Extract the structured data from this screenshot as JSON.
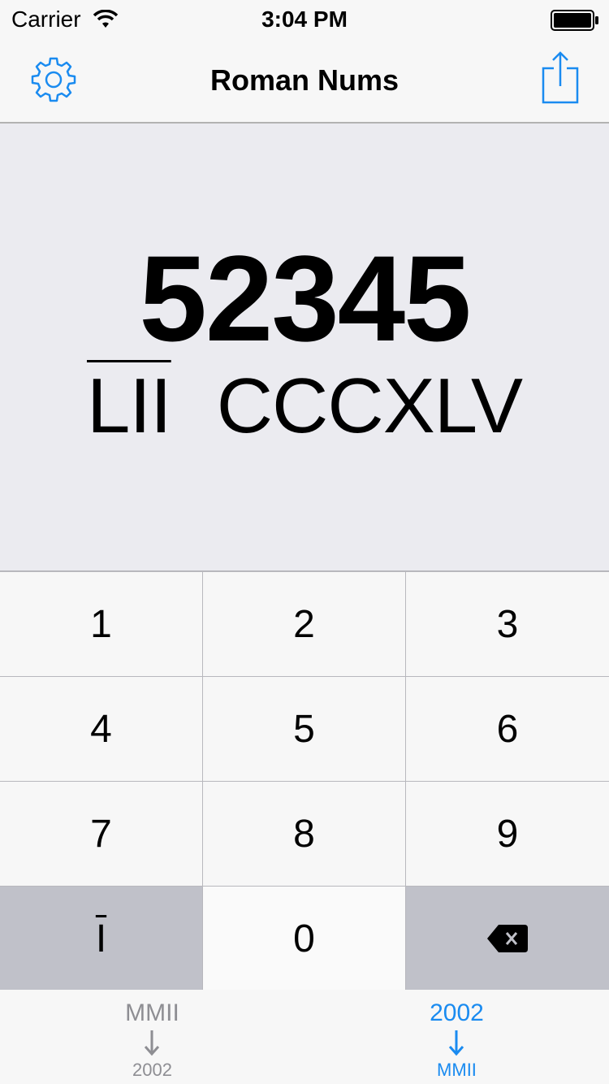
{
  "status_bar": {
    "carrier": "Carrier",
    "time": "3:04 PM"
  },
  "nav": {
    "title": "Roman Nums",
    "left_icon": "gear-icon",
    "right_icon": "share-icon"
  },
  "display": {
    "arabic": "52345",
    "roman_overlined": "LII",
    "roman_plain": "CCCXLV"
  },
  "keypad": {
    "keys": [
      "1",
      "2",
      "3",
      "4",
      "5",
      "6",
      "7",
      "8",
      "9",
      "I",
      "0"
    ],
    "delete_icon": "backspace-icon"
  },
  "tabs": [
    {
      "top": "MMII",
      "bottom": "2002",
      "selected": false
    },
    {
      "top": "2002",
      "bottom": "MMII",
      "selected": true
    }
  ],
  "colors": {
    "accent": "#1a8bf0",
    "display_bg": "#ebebf0",
    "dark_key": "#c0c1c9",
    "inactive_tab": "#8e8e93"
  }
}
